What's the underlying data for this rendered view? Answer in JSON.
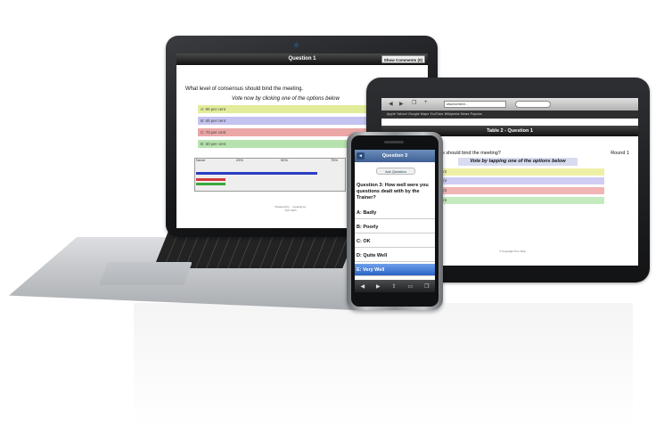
{
  "laptop": {
    "title": "Question 1",
    "show_button": "Show Comments (0)",
    "question": "What level of consensus should bind the meeting.",
    "vote_prompt": "Vote now by clicking one of the options below",
    "options": [
      {
        "label": "A: 90 per cent",
        "color": "#e3ec9a"
      },
      {
        "label": "B: 80 per cent",
        "color": "#c4c2ef"
      },
      {
        "label": "C: 70 per cent",
        "color": "#eba6a6"
      },
      {
        "label": "D: 60 per cent",
        "color": "#b6e3ad"
      }
    ],
    "results_label": "Never",
    "ticks": [
      "25%",
      "50%",
      "75%"
    ],
    "result_bars": [
      {
        "color": "#2b3fc2",
        "fraction": 0.82
      },
      {
        "color": "#d43a3a",
        "fraction": 0.2
      },
      {
        "color": "#3aa83a",
        "fraction": 0.2
      }
    ],
    "footer": "Powered by ... meeting by Turn Tech"
  },
  "tablet": {
    "url": "www.turntech...",
    "bookmarks": "Apple  Yahoo!  Google Maps  YouTube  Wikipedia  News  Popular",
    "title": "Table 2 - Question 1",
    "question": "...consensus should bind the meeting?",
    "round": "Round 1",
    "vote_prompt": "Vote by tapping one of the options below",
    "options": [
      {
        "label": "...per cent",
        "color": "#eef0a6"
      },
      {
        "label": "...per cent",
        "color": "#cfcdf2"
      },
      {
        "label": "...per cent",
        "color": "#f0b4b4"
      },
      {
        "label": "...per cent",
        "color": "#c4ebbd"
      }
    ],
    "footer": "© Copyright Turn Tech"
  },
  "phone": {
    "title": "Question 3",
    "back": "◂",
    "sub_button": "Ask Question",
    "question": "Question 3: How well were you questions dealt with by the Trainer?",
    "options": [
      {
        "label": "A: Badly",
        "selected": false
      },
      {
        "label": "B: Poorly",
        "selected": false
      },
      {
        "label": "C: OK",
        "selected": false
      },
      {
        "label": "D: Quite Well",
        "selected": false
      },
      {
        "label": "E: Very Well",
        "selected": true
      }
    ],
    "nav_icons": [
      "back-icon",
      "forward-icon",
      "share-icon",
      "bookmarks-icon",
      "tabs-icon"
    ]
  }
}
